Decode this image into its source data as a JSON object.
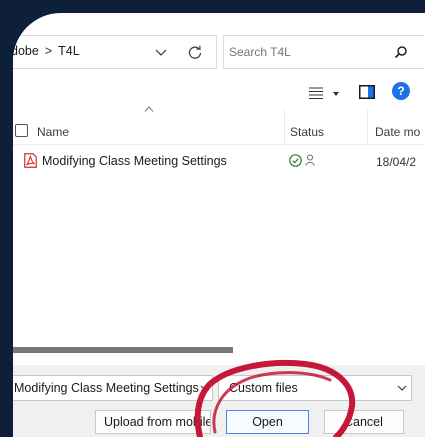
{
  "address_bar": {
    "crumbs": [
      "dobe",
      "T4L"
    ],
    "separator": ">"
  },
  "search": {
    "placeholder": "Search T4L"
  },
  "toolbar": {
    "help_label": "?"
  },
  "columns": [
    {
      "label": "Name"
    },
    {
      "label": "Status"
    },
    {
      "label": "Date mo"
    }
  ],
  "files": [
    {
      "name": "Modifying Class Meeting Settings",
      "date": "18/04/2"
    }
  ],
  "footer": {
    "file_name_value": "Modifying Class Meeting Settings",
    "file_type_value": "Custom files",
    "upload_label": "Upload from mobile",
    "open_label": "Open",
    "cancel_label": "Cancel"
  },
  "colors": {
    "frame": "#0d1f3b",
    "accent": "#1a73e8",
    "pdf": "#d32f2f",
    "status_ok": "#2e7d32",
    "annotation": "#c4173a"
  }
}
